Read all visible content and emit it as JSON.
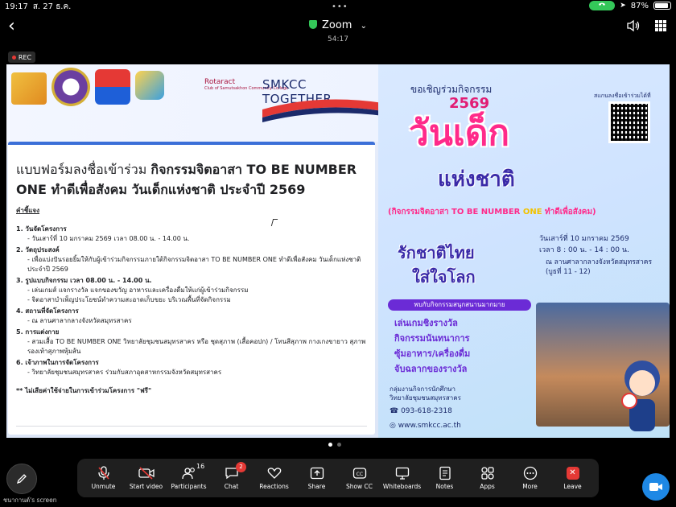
{
  "status": {
    "time": "19:17",
    "date": "ส. 27 ธ.ค.",
    "battery": "87%",
    "battery_level": 0.87
  },
  "header": {
    "title": "Zoom",
    "elapsed": "54:17",
    "rec_label": "REC"
  },
  "share": {
    "logos": {
      "rotaract": "Rotaract",
      "rotaract_sub": "Club of Samutsakhon Community College",
      "smkcc": "SMKCC TOGETHER"
    },
    "form": {
      "title_plain": "แบบฟอร์มลงชื่อเข้าร่วม ",
      "title_bold": "กิจกรรมจิตอาสา TO BE NUMBER ONE ทำดีเพื่อสังคม วันเด็กแห่งชาติ ประจำปี 2569",
      "explain": "คำชี้แจง",
      "lines": [
        {
          "t": "1. วันจัดโครงการ",
          "k": "h"
        },
        {
          "t": "- วันเสาร์ที่ 10 มกราคม 2569  เวลา 08.00 น. - 14.00 น.",
          "k": "i"
        },
        {
          "t": "2. วัตถุประสงค์",
          "k": "h"
        },
        {
          "t": "- เพื่อแบ่งปันรอยยิ้มให้กับผู้เข้าร่วมกิจกรรมภายใต้กิจกรรมจิตอาสา TO BE NUMBER ONE ทำดีเพื่อสังคม วันเด็กแห่งชาติ ประจำปี 2569",
          "k": "i"
        },
        {
          "t": "3. รูปแบบกิจกรรม  เวลา 08.00 น. - 14.00 น.",
          "k": "h"
        },
        {
          "t": "- เล่นเกมส์ แจกรางวัล แจกของขวัญ อาหารและเครื่องดื่มให้แก่ผู้เข้าร่วมกิจกรรม",
          "k": "i"
        },
        {
          "t": "- จิตอาสาบำเพ็ญประโยชน์ทำความสะอาดเก็บขยะ บริเวณพื้นที่จัดกิจกรรม",
          "k": "i"
        },
        {
          "t": "4. สถานที่จัดโครงการ",
          "k": "h"
        },
        {
          "t": "- ณ ลานศาลากลางจังหวัดสมุทรสาคร",
          "k": "i"
        },
        {
          "t": "5. การแต่งกาย",
          "k": "h"
        },
        {
          "t": "- สวมเสื้อ TO BE NUMBER ONE วิทยาลัยชุมชนสมุทรสาคร หรือ ชุดสุภาพ (เสื้อคอปก) / โทนสีสุภาพ กางเกงขายาว สุภาพ รองเท้าสุภาพหุ้มส้น",
          "k": "i"
        },
        {
          "t": "6. เจ้าภาพในการจัดโครงการ",
          "k": "h"
        },
        {
          "t": "- วิทยาลัยชุมชนสมุทรสาคร ร่วมกับสภาอุตสาหกรรมจังหวัดสมุทรสาคร",
          "k": "i"
        }
      ],
      "note": "** ไม่เสียค่าใช้จ่ายในการเข้าร่วมโครงการ \"ฟรี\""
    },
    "poster": {
      "invite": "ขอเชิญร่วมกิจกรรม",
      "year": "2569",
      "big1": "วันเด็ก",
      "big2": "แห่งชาติ",
      "sub_a": "(กิจกรรมจิตอาสา TO BE NUMBER ",
      "sub_b": "ONE",
      "sub_c": " ทำดีเพื่อสังคม)",
      "love1": "รักชาติไทย",
      "love2": "ใส่ใจโลก",
      "scan": "สแกนลงชื่อเข้าร่วมได้ที่",
      "date": "วันเสาร์ที่ 10 มกราคม 2569",
      "time": "เวลา 8 : 00 น. - 14 : 00 น.",
      "place1": "ณ ลานศาลากลางจังหวัดสมุทรสาคร",
      "place2": "(บูธที่ 11 - 12)",
      "banner": "พบกับกิจกรรมสนุกสนานมากมาย",
      "acts": [
        "เล่นเกมชิงรางวัล",
        "กิจกรรมนันทนาการ",
        "ซุ้มอาหาร/เครื่องดื่ม",
        "จับฉลากของรางวัล"
      ],
      "contact1": "กลุ่มงานกิจการนักศึกษา",
      "contact2": "วิทยาลัยชุมชนสมุทรสาคร",
      "phone": "093-618-2318",
      "web": "www.smkcc.ac.th"
    }
  },
  "toolbar": {
    "items": [
      {
        "label": "Unmute",
        "icon": "mic-off-icon"
      },
      {
        "label": "Start video",
        "icon": "video-off-icon"
      },
      {
        "label": "Participants",
        "icon": "participants-icon",
        "count": "16"
      },
      {
        "label": "Chat",
        "icon": "chat-icon",
        "badge": "2"
      },
      {
        "label": "Reactions",
        "icon": "heart-icon"
      },
      {
        "label": "Share",
        "icon": "share-icon"
      },
      {
        "label": "Show CC",
        "icon": "cc-icon"
      },
      {
        "label": "Whiteboards",
        "icon": "whiteboard-icon"
      },
      {
        "label": "Notes",
        "icon": "notes-icon"
      },
      {
        "label": "Apps",
        "icon": "apps-icon"
      },
      {
        "label": "More",
        "icon": "more-icon"
      },
      {
        "label": "Leave",
        "icon": "leave-icon"
      }
    ]
  },
  "footer": {
    "screen_owner": "ชนากานต์'s screen"
  },
  "colors": {
    "accent": "#1e88e5",
    "danger": "#e53935",
    "secure": "#34c759",
    "toolbar_bg": "#1f1f1f"
  }
}
